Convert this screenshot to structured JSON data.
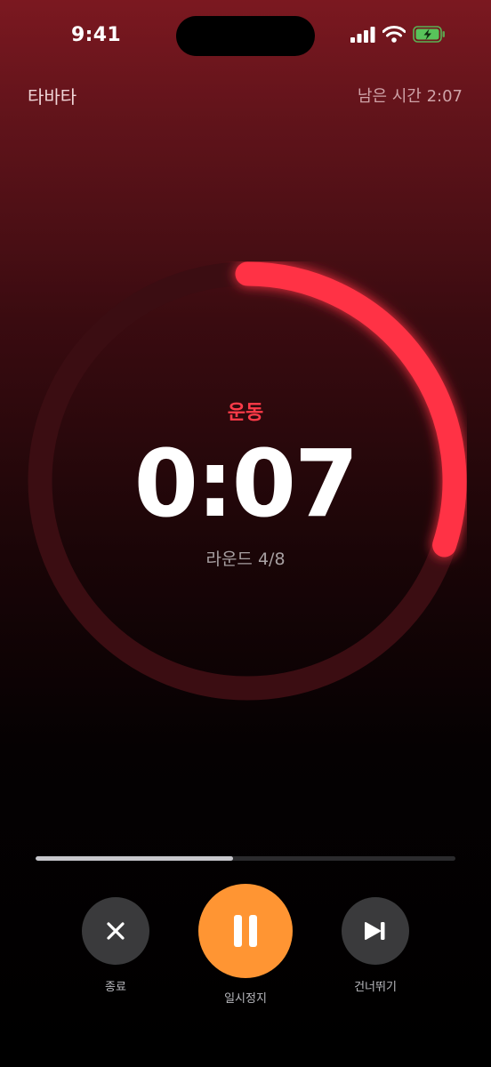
{
  "status_bar": {
    "time": "9:41"
  },
  "header": {
    "title": "타바타",
    "remaining": "남은 시간 2:07"
  },
  "timer": {
    "phase": "운동",
    "time": "0:07",
    "round": "라운드 4/8",
    "ring_progress": 0.3,
    "ring_color": "#ff3344",
    "ring_track_color": "#3b0d12"
  },
  "workout_progress": 0.47,
  "controls": {
    "end_label": "종료",
    "pause_label": "일시정지",
    "skip_label": "건너뛰기",
    "end_icon": "close-icon",
    "pause_icon": "pause-icon",
    "skip_icon": "skip-forward-icon",
    "accent_color": "#ff9533"
  }
}
